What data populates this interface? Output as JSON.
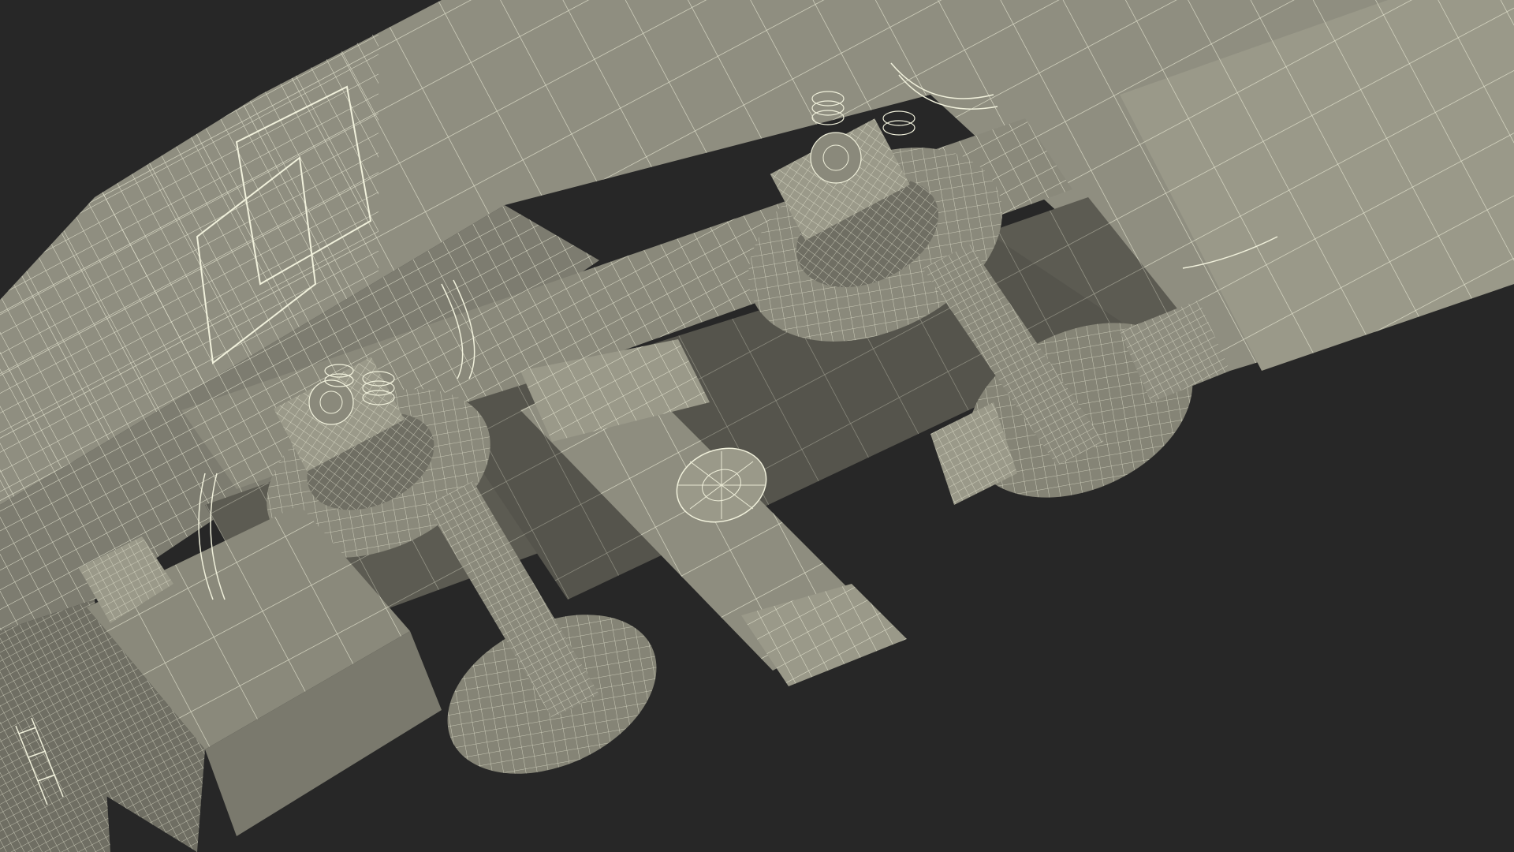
{
  "scene": {
    "subject": "wireframe-render-train-bogie-undercarriage",
    "render_style": "wireframe-over-shaded",
    "colors": {
      "background": "#272727",
      "body_fill": "#8f8e80",
      "body_fill_light": "#a3a293",
      "body_fill_dark": "#6f6e63",
      "shadow_fill": "#55544c",
      "wire": "#f1f1dc"
    }
  }
}
